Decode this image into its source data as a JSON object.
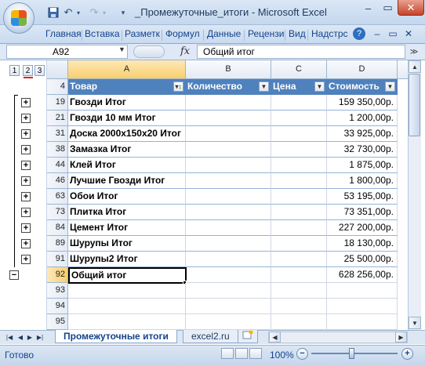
{
  "window": {
    "title": "_Промежуточные_итоги - Microsoft Excel",
    "quick_access": {
      "save_icon": "save-icon",
      "undo_icon": "undo-icon",
      "redo_icon": "redo-icon",
      "customize_icon": "chevron-down-icon"
    },
    "controls": {
      "minimize": "–",
      "maximize": "▭",
      "close": "✕"
    }
  },
  "ribbon": {
    "tabs": [
      "Главная",
      "Вставка",
      "Разметк",
      "Формул",
      "Данные",
      "Рецензи",
      "Вид",
      "Надстрс"
    ],
    "help_icon": "?",
    "ribbon_min": "–",
    "ribbon_restore": "▭",
    "ribbon_close": "✕"
  },
  "formula_bar": {
    "name_box": "A92",
    "fx": "fx",
    "formula": "Общий итог",
    "expand": "≫"
  },
  "outline": {
    "levels": [
      "1",
      "2",
      "3"
    ],
    "active_level": "2",
    "row_buttons": [
      "+",
      "+",
      "+",
      "+",
      "+",
      "+",
      "+",
      "+",
      "+",
      "+",
      "+"
    ],
    "collapse_button": "−"
  },
  "columns": [
    "A",
    "B",
    "C",
    "D"
  ],
  "selected_column": "A",
  "table": {
    "headers": [
      "Товар",
      "Количество",
      "Цена",
      "Стоимость"
    ],
    "header_row": "4",
    "rows": [
      {
        "row": "19",
        "name": "Гвозди Итог",
        "value": "159 350,00р."
      },
      {
        "row": "21",
        "name": "Гвозди 10 мм Итог",
        "value": "1 200,00р."
      },
      {
        "row": "31",
        "name": "Доска 2000х150х20 Итог",
        "value": "33 925,00р."
      },
      {
        "row": "38",
        "name": "Замазка Итог",
        "value": "32 730,00р."
      },
      {
        "row": "44",
        "name": "Клей Итог",
        "value": "1 875,00р."
      },
      {
        "row": "46",
        "name": "Лучшие Гвозди Итог",
        "value": "1 800,00р."
      },
      {
        "row": "63",
        "name": "Обои Итог",
        "value": "53 195,00р."
      },
      {
        "row": "73",
        "name": "Плитка Итог",
        "value": "73 351,00р."
      },
      {
        "row": "84",
        "name": "Цемент Итог",
        "value": "227 200,00р."
      },
      {
        "row": "89",
        "name": "Шурупы Итог",
        "value": "18 130,00р."
      },
      {
        "row": "91",
        "name": "Шурупы2 Итог",
        "value": "25 500,00р."
      }
    ],
    "total": {
      "row": "92",
      "name": "Общий итог",
      "value": "628 256,00р."
    },
    "empty_rows": [
      "93",
      "94",
      "95"
    ]
  },
  "sheets": {
    "tabs": [
      "Промежуточные итоги",
      "excel2.ru"
    ],
    "active": "Промежуточные итоги"
  },
  "status": {
    "text": "Готово",
    "zoom": "100%",
    "zoom_minus": "−",
    "zoom_plus": "+"
  }
}
